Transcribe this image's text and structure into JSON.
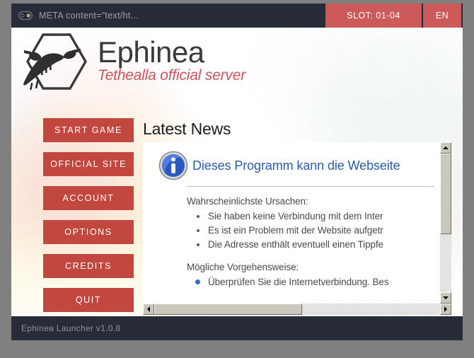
{
  "window": {
    "titlebar": {
      "icon": "gamepad-icon",
      "title": "META content=\"text/ht...",
      "slot_label": "SLOT: 01-04",
      "lang_label": "EN"
    },
    "statusbar": {
      "text": "Ephinea Launcher v1.0.8"
    }
  },
  "branding": {
    "logo_name": "Ephinea",
    "logo_tagline": "Tethealla official server",
    "logo_mark": "hexagon-rappy-icon"
  },
  "menu": {
    "items": [
      {
        "label": "START GAME",
        "name": "start-game"
      },
      {
        "label": "OFFICIAL SITE",
        "name": "official-site"
      },
      {
        "label": "ACCOUNT",
        "name": "account"
      },
      {
        "label": "OPTIONS",
        "name": "options"
      },
      {
        "label": "CREDITS",
        "name": "credits"
      },
      {
        "label": "QUIT",
        "name": "quit"
      }
    ]
  },
  "news": {
    "heading": "Latest News",
    "embedded_page": {
      "icon": "info-icon",
      "headline": "Dieses Programm kann die Webseite",
      "causes_heading": "Wahrscheinlichste Ursachen:",
      "causes": [
        "Sie haben keine Verbindung mit dem Inter",
        "Es ist ein Problem mit der Website aufgetr",
        "Die Adresse enthält eventuell einen Tippfe"
      ],
      "actions_heading": "Mögliche Vorgehensweise:",
      "actions": [
        "Überprüfen Sie die Internetverbindung. Bes"
      ]
    },
    "vertical_scrollbar": {
      "up_arrow": "triangle-up-icon",
      "down_arrow": "triangle-down-icon"
    },
    "horizontal_scrollbar": {
      "left_arrow": "triangle-left-icon",
      "right_arrow": "triangle-right-icon"
    }
  },
  "colors": {
    "titlebar_bg": "#282c38",
    "accent_red": "#cd5a5a",
    "button_red": "#c2473f",
    "logo_sub_red": "#c9545c",
    "link_blue": "#2b5ca8",
    "desktop_gray": "#808080"
  }
}
